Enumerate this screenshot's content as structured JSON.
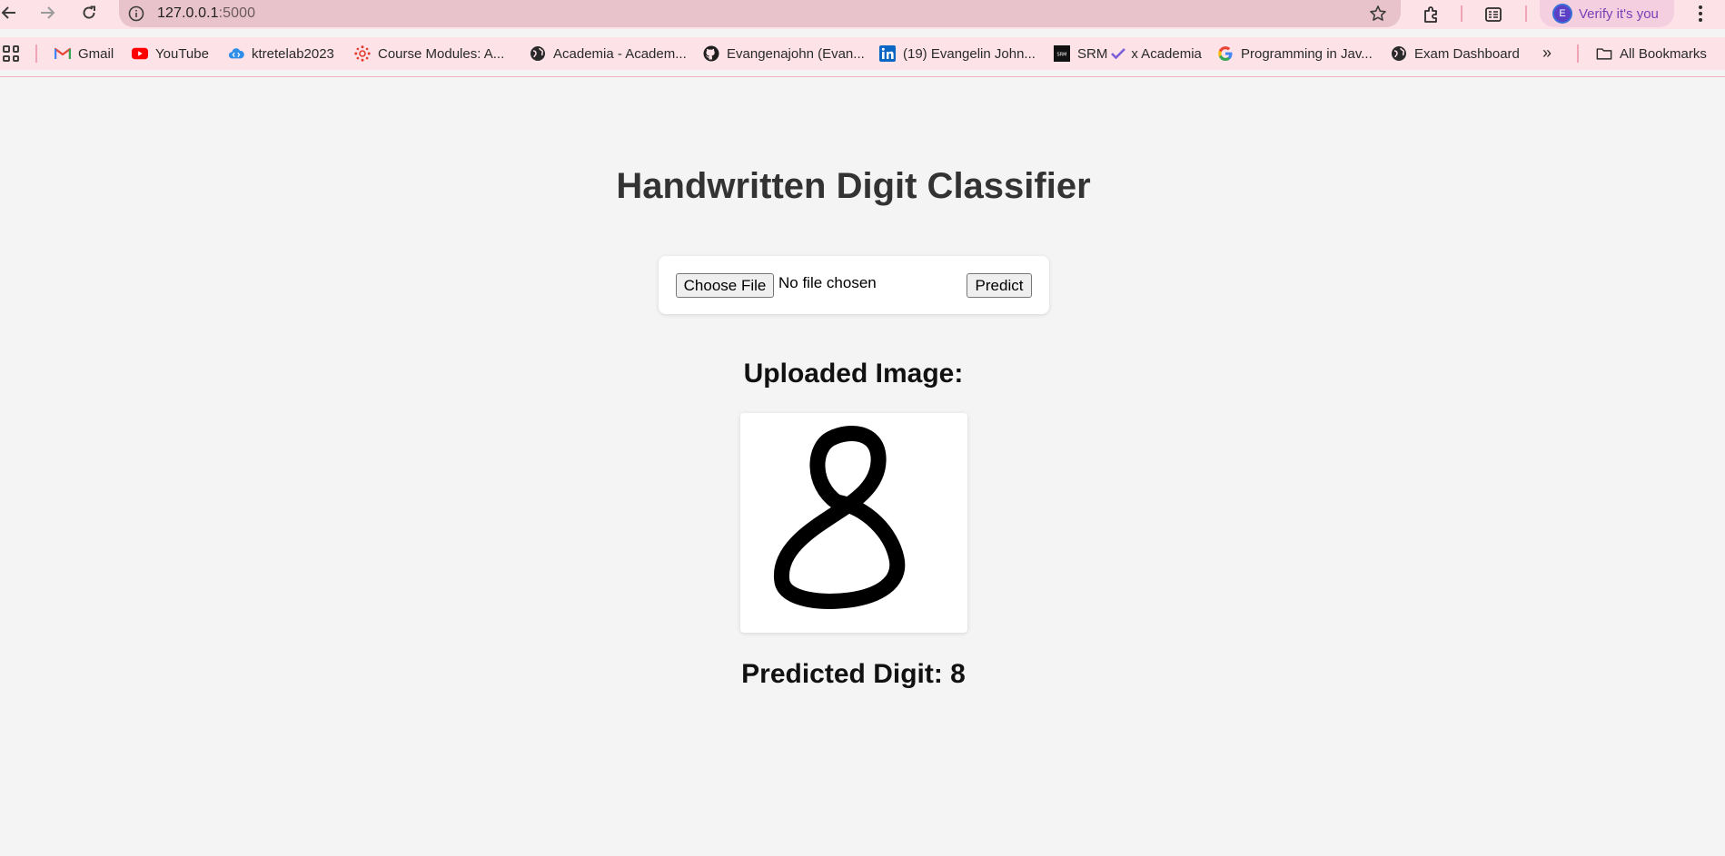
{
  "browser": {
    "url_host": "127.0.0.1",
    "url_port": ":5000",
    "verify_label": "Verify it's you",
    "avatar_letter": "E"
  },
  "bookmarks": [
    {
      "label": "Gmail",
      "icon": "gmail-icon"
    },
    {
      "label": "YouTube",
      "icon": "youtube-icon"
    },
    {
      "label": "ktretelab2023",
      "icon": "cloud-code-icon"
    },
    {
      "label": "Course Modules: A...",
      "icon": "canvas-icon"
    },
    {
      "label": "Academia - Academ...",
      "icon": "globe-icon"
    },
    {
      "label": "Evangenajohn (Evan...",
      "icon": "github-icon"
    },
    {
      "label": "(19) Evangelin John...",
      "icon": "linkedin-icon"
    },
    {
      "label": "SRM",
      "suffix": "x Academia",
      "icon": "srm-icon"
    },
    {
      "label": "Programming in Jav...",
      "icon": "google-icon"
    },
    {
      "label": "Exam Dashboard",
      "icon": "globe-icon"
    }
  ],
  "bookmarks_more": "»",
  "all_bookmarks_label": "All Bookmarks",
  "page": {
    "title": "Handwritten Digit Classifier",
    "choose_file_label": "Choose File",
    "file_status": "No file chosen",
    "predict_label": "Predict",
    "uploaded_heading": "Uploaded Image:",
    "prediction_text": "Predicted Digit: 8"
  },
  "colors": {
    "chrome_bg": "#fde2e8",
    "omnibox_bg": "#e8c3cb",
    "page_bg": "#f4f4f4",
    "title_color": "#333333",
    "verify_text": "#7b3fb6"
  }
}
